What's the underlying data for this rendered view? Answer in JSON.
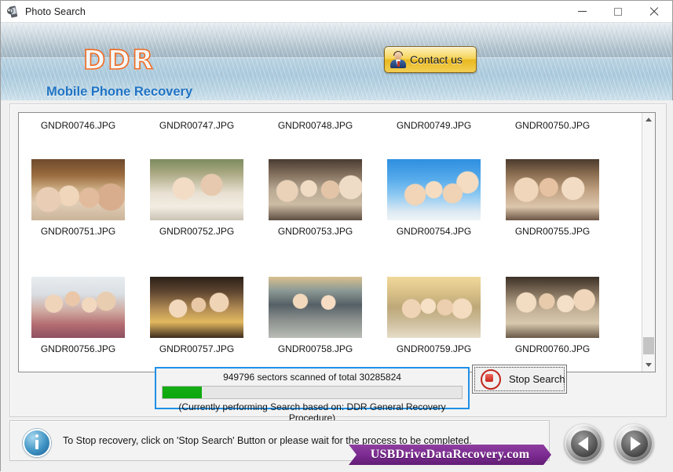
{
  "window": {
    "title": "Photo Search",
    "icon": "mobile-phone-icon",
    "controls": {
      "minimize": "–",
      "maximize": "☐",
      "close": "✕"
    }
  },
  "banner": {
    "logo": "DDR",
    "subtitle": "Mobile Phone Recovery",
    "contact_button": {
      "label": "Contact us",
      "icon": "user-avatar-icon"
    }
  },
  "file_grid": {
    "rows": [
      {
        "type": "labels",
        "cells": [
          {
            "filename": "GNDR00746.JPG"
          },
          {
            "filename": "GNDR00747.JPG"
          },
          {
            "filename": "GNDR00748.JPG"
          },
          {
            "filename": "GNDR00749.JPG"
          },
          {
            "filename": "GNDR00750.JPG"
          }
        ]
      },
      {
        "type": "thumbnails",
        "cells": [
          {
            "filename": "GNDR00751.JPG",
            "photo": "ph1"
          },
          {
            "filename": "GNDR00752.JPG",
            "photo": "ph2"
          },
          {
            "filename": "GNDR00753.JPG",
            "photo": "ph3"
          },
          {
            "filename": "GNDR00754.JPG",
            "photo": "ph4"
          },
          {
            "filename": "GNDR00755.JPG",
            "photo": "ph5"
          }
        ]
      },
      {
        "type": "thumbnails",
        "cells": [
          {
            "filename": "GNDR00756.JPG",
            "photo": "ph6"
          },
          {
            "filename": "GNDR00757.JPG",
            "photo": "ph7"
          },
          {
            "filename": "GNDR00758.JPG",
            "photo": "ph8"
          },
          {
            "filename": "GNDR00759.JPG",
            "photo": "ph9"
          },
          {
            "filename": "GNDR00760.JPG",
            "photo": "ph10"
          }
        ]
      }
    ],
    "scrollbar": {
      "up_arrow": "scroll-up-icon",
      "down_arrow": "scroll-down-icon"
    }
  },
  "search": {
    "sectors_text": "949796  sectors scanned of total 30285824",
    "sectors_scanned": 949796,
    "sectors_total": 30285824,
    "progress_percent": 13,
    "progress_color": "#0aa80a",
    "based_on": "(Currently performing Search based on:  DDR General Recovery Procedure)",
    "border_color": "#1e90e8",
    "stop_button": {
      "label": "Stop Search",
      "icon": "stop-icon"
    }
  },
  "status": {
    "icon": "info-icon",
    "message": "To Stop recovery, click on 'Stop Search' Button or please wait for the process to be completed."
  },
  "watermark": {
    "text": "USBDriveDataRecovery.com",
    "color": "#7b2a90"
  },
  "navigation": {
    "previous": {
      "icon": "arrow-left-icon"
    },
    "next": {
      "icon": "arrow-right-icon"
    }
  }
}
